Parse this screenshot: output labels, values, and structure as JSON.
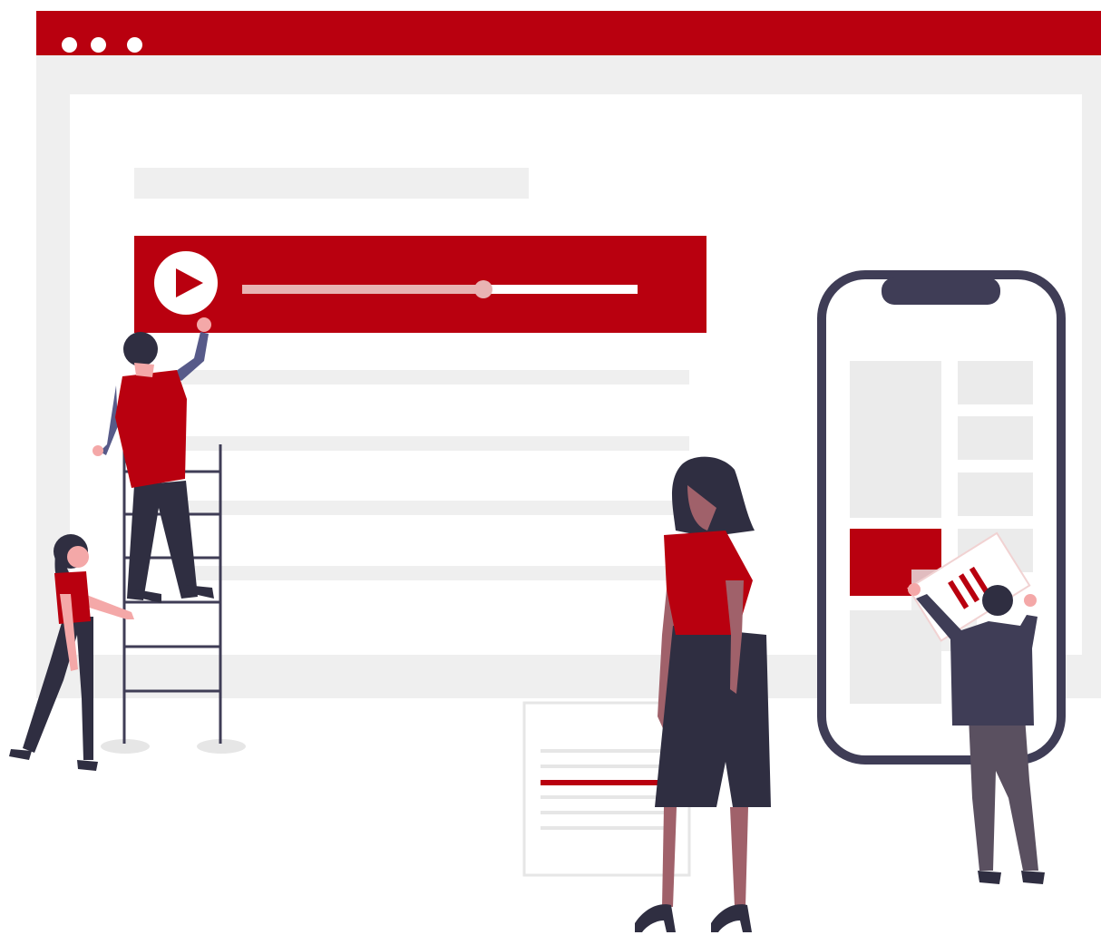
{
  "colors": {
    "accent": "#b9000f",
    "frame": "#efefef",
    "placeholder": "#ebebeb",
    "dark": "#3f3d56",
    "skin_light": "#f4a8a8",
    "skin_dark": "#a0616a",
    "progress_track": "#ffffff",
    "progress_played": "#e8b3b3"
  },
  "browser": {
    "window_controls": [
      "window-dot",
      "window-dot",
      "window-dot"
    ]
  },
  "video_player": {
    "icon": "play-icon",
    "progress_fraction": 0.61
  },
  "phone": {
    "notch": true
  },
  "document_card": {
    "highlighted_line_index": 2
  }
}
